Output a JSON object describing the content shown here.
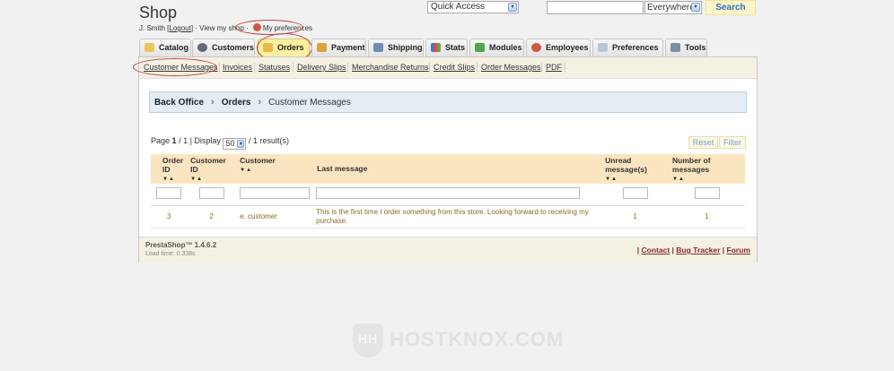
{
  "header": {
    "shop_title": "Shop",
    "user_name": "J. Smith [",
    "logout_label": "Logout",
    "user_tail": "] · View my shop · ",
    "my_preferences_label": "My preferences",
    "quick_access_label": "Quick Access",
    "search_value": "",
    "search_scope": "Everywhere",
    "search_button": "Search"
  },
  "tabs": [
    {
      "label": "Catalog",
      "icon": "folder-icon",
      "active": false
    },
    {
      "label": "Customers",
      "icon": "user-icon",
      "active": false
    },
    {
      "label": "Orders",
      "icon": "orders-icon",
      "active": true
    },
    {
      "label": "Payment",
      "icon": "payment-icon",
      "active": false
    },
    {
      "label": "Shipping",
      "icon": "truck-icon",
      "active": false
    },
    {
      "label": "Stats",
      "icon": "chart-icon",
      "active": false
    },
    {
      "label": "Modules",
      "icon": "puzzle-icon",
      "active": false
    },
    {
      "label": "Employees",
      "icon": "employee-icon",
      "active": false
    },
    {
      "label": "Preferences",
      "icon": "preferences-icon",
      "active": false
    },
    {
      "label": "Tools",
      "icon": "wrench-icon",
      "active": false
    }
  ],
  "subnav": [
    "Customer Messages",
    "Invoices",
    "Statuses",
    "Delivery Slips",
    "Merchandise Returns",
    "Credit Slips",
    "Order Messages",
    "PDF"
  ],
  "breadcrumb": {
    "level1": "Back Office",
    "level2": "Orders",
    "level3": "Customer Messages"
  },
  "pagination": {
    "page_label": "Page",
    "current_page": "1",
    "total_pages": "/ 1 | Display",
    "per_page": "50",
    "results": "/ 1 result(s)"
  },
  "buttons": {
    "reset": "Reset",
    "filter": "Filter"
  },
  "table": {
    "headers": {
      "order_id": "Order ID",
      "customer_id": "Customer ID",
      "customer": "Customer",
      "last_message": "Last message",
      "unread": "Unread message(s)",
      "number": "Number of messages"
    },
    "rows": [
      {
        "order_id": "3",
        "customer_id": "2",
        "customer": "e. customer",
        "last_message": "This is the first time I order something from this store. Looking forward to receiving my purchase.",
        "unread": "1",
        "number": "1"
      }
    ]
  },
  "footer": {
    "version": "PrestaShop™ 1.4.6.2",
    "load_time": "Load time: 0.338s",
    "contact": "Contact",
    "bug_tracker": "Bug Tracker",
    "forum": "Forum"
  },
  "watermark": "HOSTKNOX.COM",
  "colors": {
    "active_tab": "#fff1a1",
    "subnav_bg": "#f4f1e3",
    "table_header_bg": "#fbe5c0",
    "breadcrumb_bg": "#e4edf3",
    "link_accent": "#8a2a2a"
  }
}
